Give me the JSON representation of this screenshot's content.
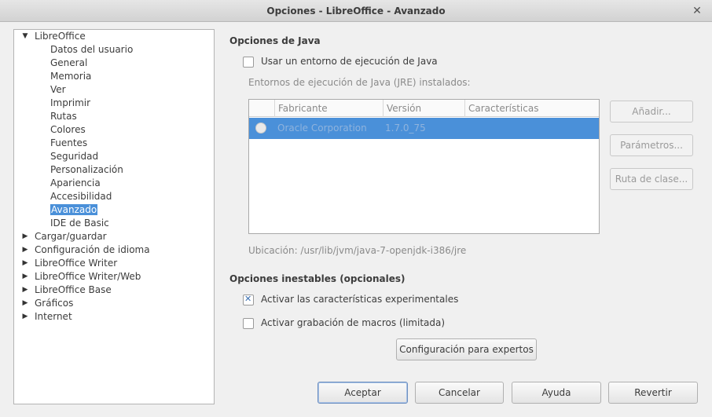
{
  "window": {
    "title": "Opciones - LibreOffice - Avanzado",
    "close_icon": "close-icon"
  },
  "tree": {
    "root": "LibreOffice",
    "children": [
      "Datos del usuario",
      "General",
      "Memoria",
      "Ver",
      "Imprimir",
      "Rutas",
      "Colores",
      "Fuentes",
      "Seguridad",
      "Personalización",
      "Apariencia",
      "Accesibilidad",
      "Avanzado",
      "IDE de Basic"
    ],
    "selected": "Avanzado",
    "collapsed": [
      "Cargar/guardar",
      "Configuración de idioma",
      "LibreOffice Writer",
      "LibreOffice Writer/Web",
      "LibreOffice Base",
      "Gráficos",
      "Internet"
    ]
  },
  "java": {
    "section_title": "Opciones de Java",
    "use_jre_label": "Usar un entorno de ejecución de Java",
    "use_jre_checked": false,
    "installed_label": "Entornos de ejecución de Java (JRE) instalados:",
    "columns": [
      "Fabricante",
      "Versión",
      "Características"
    ],
    "rows": [
      {
        "vendor": "Oracle Corporation",
        "version": "1.7.0_75",
        "features": ""
      }
    ],
    "location_label": "Ubicación: /usr/lib/jvm/java-7-openjdk-i386/jre",
    "buttons": {
      "add": "Añadir...",
      "parameters": "Parámetros...",
      "classpath": "Ruta de clase..."
    }
  },
  "unstable": {
    "section_title": "Opciones inestables (opcionales)",
    "experimental_label": "Activar las características experimentales",
    "experimental_checked": true,
    "macro_label": "Activar grabación de macros (limitada)",
    "macro_checked": false,
    "expert_button": "Configuración para expertos"
  },
  "footer": {
    "ok": "Aceptar",
    "cancel": "Cancelar",
    "help": "Ayuda",
    "revert": "Revertir"
  },
  "colors": {
    "selection": "#4a90d9"
  }
}
